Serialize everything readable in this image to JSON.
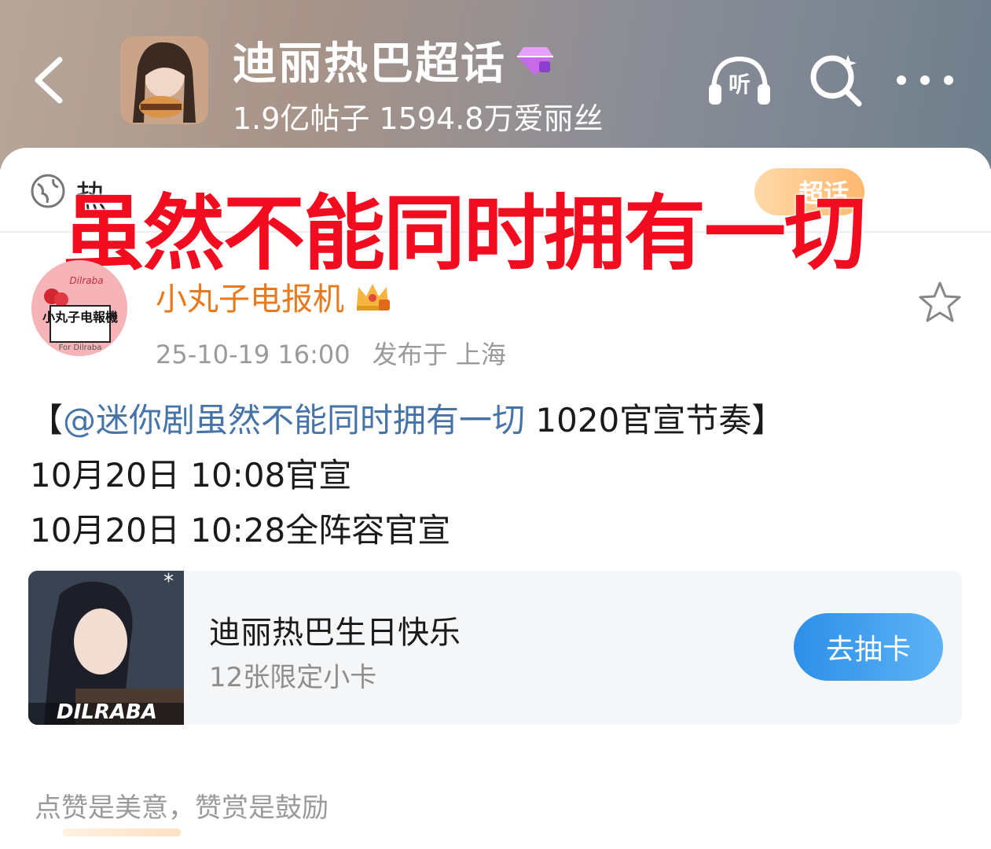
{
  "header": {
    "topic_title": "迪丽热巴超话",
    "topic_stats": "1.9亿帖子 1594.8万爱丽丝",
    "listen_icon_label": "听"
  },
  "card": {
    "tab_label": "热",
    "super_badge": "超话",
    "overlay_title": "虽然不能同时拥有一切"
  },
  "post": {
    "author": {
      "name": "小丸子电报机",
      "avatar_text": "小丸子电報機",
      "avatar_top_text": "Dilraba",
      "avatar_bottom_text": "For Dilraba"
    },
    "meta": {
      "time": "25-10-19 16:00",
      "location": "发布于 上海"
    },
    "body": {
      "bracket_open": "【",
      "mention": "@迷你剧虽然不能同时拥有一切",
      "line1_rest": " 1020官宣节奏】",
      "line2": "10月20日 10:08官宣",
      "line3": "10月20日 10:28全阵容官宣"
    }
  },
  "promo": {
    "title": "迪丽热巴生日快乐",
    "subtitle": "12张限定小卡",
    "button": "去抽卡",
    "image_text": "DILRABA"
  },
  "footer": {
    "note": "点赞是美意，赞赏是鼓励"
  },
  "colors": {
    "accent_red": "#f10d1f",
    "mention_blue": "#4673a8",
    "author_orange": "#e8791c",
    "button_blue": "#2d8fe8"
  }
}
